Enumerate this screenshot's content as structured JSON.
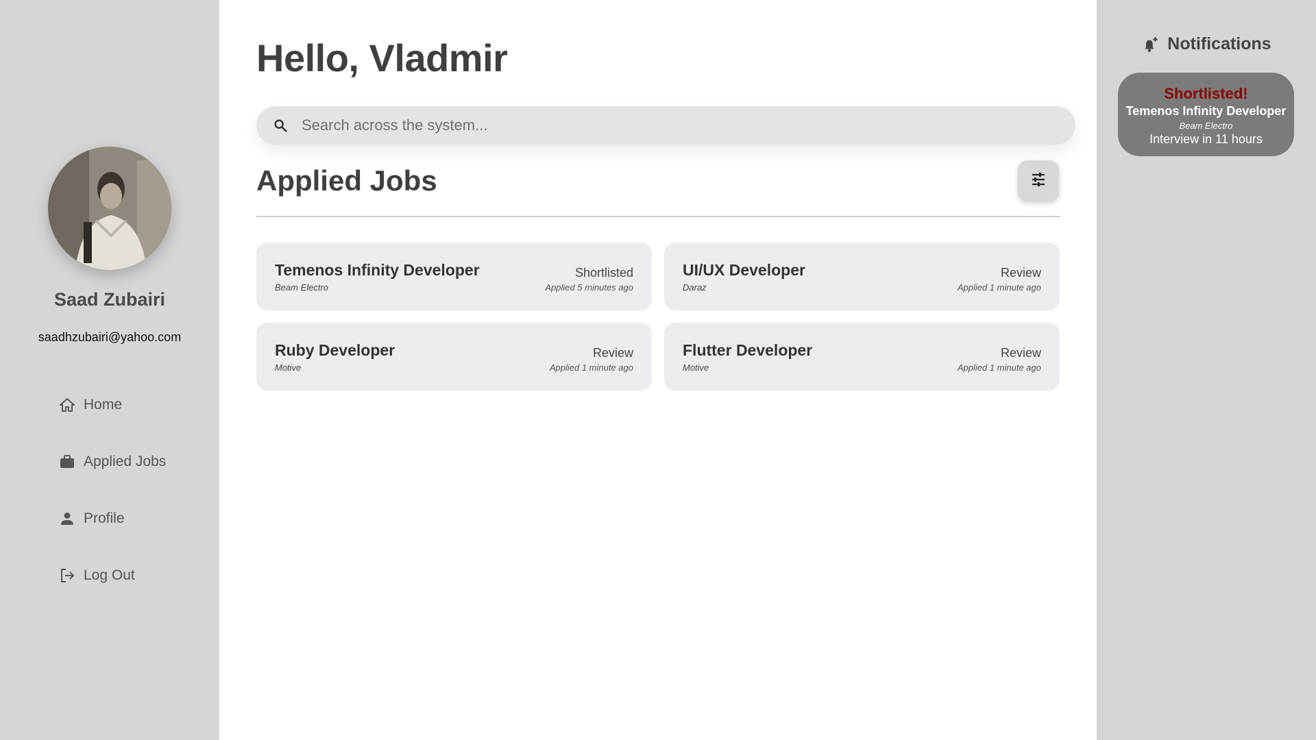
{
  "sidebar": {
    "user_name": "Saad Zubairi",
    "user_email": "saadhzubairi@yahoo.com",
    "items": [
      {
        "label": "Home",
        "icon": "home-icon"
      },
      {
        "label": "Applied Jobs",
        "icon": "briefcase-icon"
      },
      {
        "label": "Profile",
        "icon": "person-icon"
      },
      {
        "label": "Log Out",
        "icon": "logout-icon"
      }
    ]
  },
  "main": {
    "greeting": "Hello, Vladmir",
    "search": {
      "placeholder": "Search across the system...",
      "value": ""
    },
    "section_title": "Applied Jobs",
    "jobs": [
      {
        "title": "Temenos Infinity Developer",
        "company": "Beam Electro",
        "status": "Shortlisted",
        "applied": "Applied 5 minutes ago"
      },
      {
        "title": "UI/UX Developer",
        "company": "Daraz",
        "status": "Review",
        "applied": "Applied 1 minute ago"
      },
      {
        "title": "Ruby Developer",
        "company": "Motive",
        "status": "Review",
        "applied": "Applied 1 minute ago"
      },
      {
        "title": "Flutter Developer",
        "company": "Motive",
        "status": "Review",
        "applied": "Applied 1 minute ago"
      }
    ]
  },
  "notifications": {
    "title": "Notifications",
    "items": [
      {
        "status": "Shortlisted!",
        "job": "Temenos Infinity Developer",
        "company": "Beam Electro",
        "detail": "Interview in 11 hours"
      }
    ]
  },
  "colors": {
    "sidebar_bg": "#d6d6d6",
    "card_bg": "#ebedf0",
    "notif_bg": "#7b7b7b",
    "shortlisted_red": "#8a0000"
  }
}
